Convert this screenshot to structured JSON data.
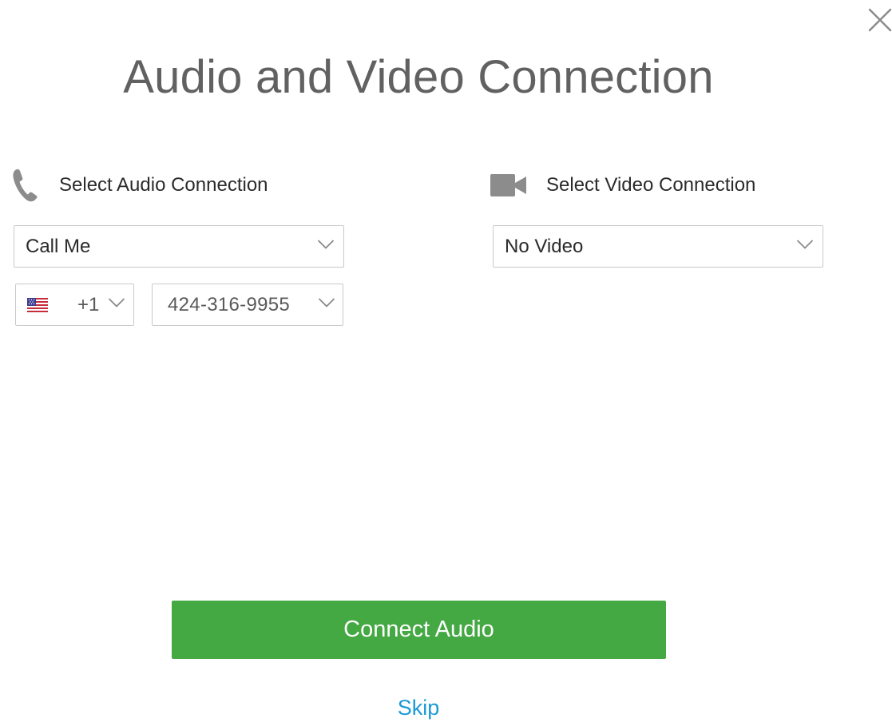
{
  "dialog": {
    "title": "Audio and Video Connection",
    "close_icon": "close-icon"
  },
  "audio": {
    "header_icon": "phone-icon",
    "header_label": "Select Audio Connection",
    "selected": "Call Me",
    "country": {
      "flag_icon": "us-flag-icon",
      "code": "+1"
    },
    "phone_number": "424-316-9955"
  },
  "video": {
    "header_icon": "video-camera-icon",
    "header_label": "Select Video Connection",
    "selected": "No Video"
  },
  "actions": {
    "connect_label": "Connect Audio",
    "skip_label": "Skip"
  },
  "colors": {
    "primary_button": "#44a843",
    "link": "#1b9ad6",
    "title_text": "#616161",
    "border": "#c9c9c9"
  }
}
